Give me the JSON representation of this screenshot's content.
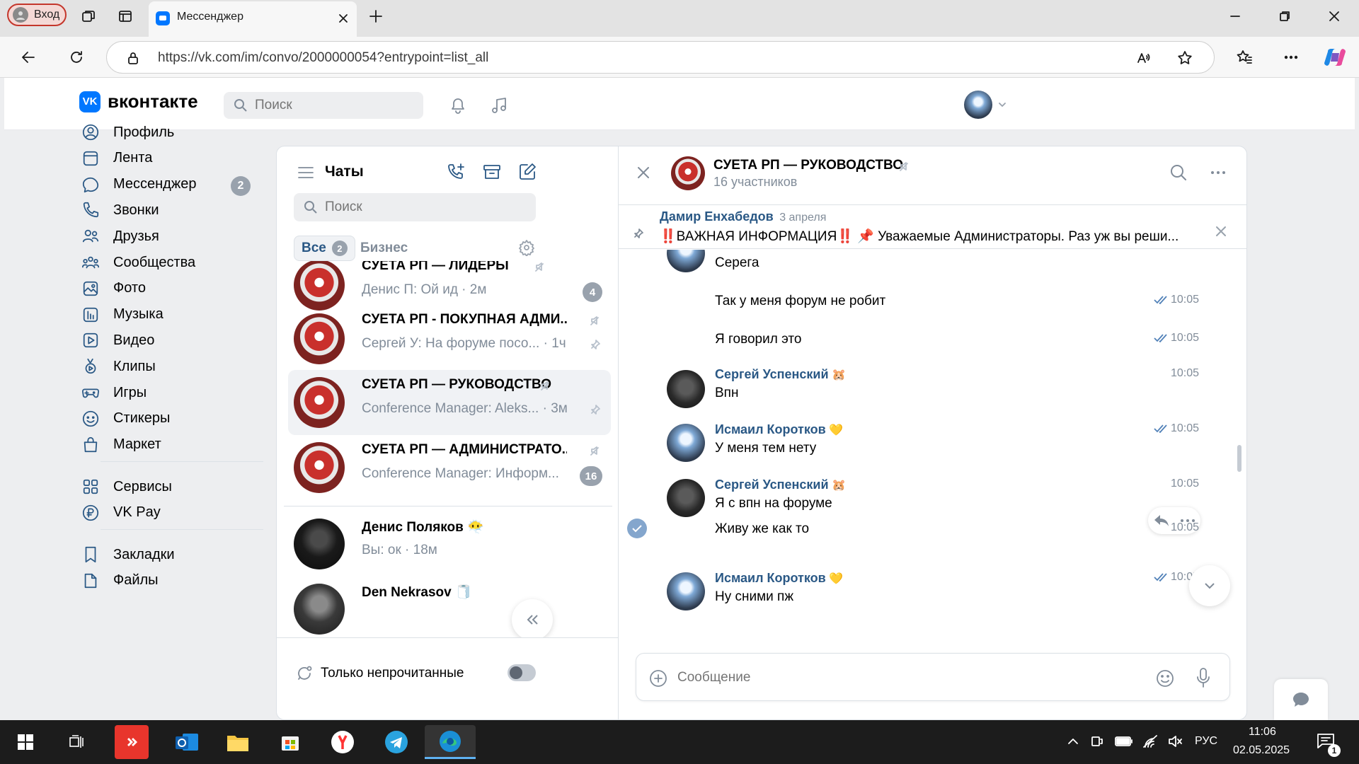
{
  "browser": {
    "profile_label": "Вход",
    "tab_title": "Мессенджер",
    "url": "https://vk.com/im/convo/2000000054?entrypoint=list_all"
  },
  "header": {
    "logo_text": "вконтакте",
    "search_placeholder": "Поиск"
  },
  "sidebar": {
    "items": [
      {
        "label": "Профиль",
        "icon": "profile-icon"
      },
      {
        "label": "Лента",
        "icon": "feed-icon"
      },
      {
        "label": "Мессенджер",
        "icon": "messenger-icon",
        "badge": "2"
      },
      {
        "label": "Звонки",
        "icon": "phone-icon"
      },
      {
        "label": "Друзья",
        "icon": "friends-icon"
      },
      {
        "label": "Сообщества",
        "icon": "communities-icon"
      },
      {
        "label": "Фото",
        "icon": "photo-icon"
      },
      {
        "label": "Музыка",
        "icon": "music-icon"
      },
      {
        "label": "Видео",
        "icon": "video-icon"
      },
      {
        "label": "Клипы",
        "icon": "clips-icon"
      },
      {
        "label": "Игры",
        "icon": "games-icon"
      },
      {
        "label": "Стикеры",
        "icon": "stickers-icon"
      },
      {
        "label": "Маркет",
        "icon": "market-icon"
      }
    ],
    "items2": [
      {
        "label": "Сервисы",
        "icon": "services-icon"
      },
      {
        "label": "VK Pay",
        "icon": "vkpay-icon"
      }
    ],
    "items3": [
      {
        "label": "Закладки",
        "icon": "bookmarks-icon"
      },
      {
        "label": "Файлы",
        "icon": "files-icon"
      }
    ]
  },
  "chatlist": {
    "title": "Чаты",
    "search_placeholder": "Поиск",
    "tabs": [
      {
        "label": "Все",
        "badge": "2"
      },
      {
        "label": "Бизнес"
      }
    ],
    "chats": [
      {
        "name": "СУЕТА РП — ЛИДЕРЫ",
        "preview": "Денис П: Ой ид · 2м",
        "count": "4",
        "muted": true
      },
      {
        "name": "СУЕТА РП - ПОКУПНАЯ АДМИ...",
        "preview": "Сергей У: На форуме посо... · 1ч",
        "muted": true,
        "pinned": true
      },
      {
        "name": "СУЕТА РП — РУКОВОДСТВО",
        "preview": "Conference Manager: Aleks... · 3м",
        "muted": true,
        "pinned": true,
        "active": true
      },
      {
        "name": "СУЕТА РП — АДМИНИСТРАТО...",
        "preview": "Conference Manager: Информ...",
        "count": "16",
        "muted": true
      },
      {
        "name": "Денис Поляков 😶‍🌫️",
        "preview": "Вы: ок · 18м"
      },
      {
        "name": "Den Nekrasov 🧻",
        "preview": ""
      }
    ],
    "unread_only_label": "Только непрочитанные"
  },
  "conversation": {
    "title": "СУЕТА РП — РУКОВОДСТВО",
    "subtitle": "16 участников",
    "pinned": {
      "author": "Дамир Енхабедов",
      "date": "3 апреля",
      "text": "‼️ВАЖНАЯ ИНФОРМАЦИЯ‼️ 📌 Уважаемые Администраторы. Раз уж вы реши..."
    },
    "messages": [
      {
        "text": "Серега"
      },
      {
        "text": "Так у меня форум не робит",
        "time": "10:05",
        "read": true
      },
      {
        "text": "Я говорил это",
        "time": "10:05",
        "read": true
      },
      {
        "author": "Сергей Успенский",
        "emoji": "🐹",
        "text": "Впн",
        "time": "10:05"
      },
      {
        "author": "Исмаил Коротков",
        "emoji": "💛",
        "text": "У меня тем нету",
        "time": "10:05",
        "read": true
      },
      {
        "author": "Сергей Успенский",
        "emoji": "🐹",
        "text": "Я с впн на форуме",
        "time": "10:05"
      },
      {
        "text": "Живу же как то",
        "time": "10:05"
      },
      {
        "author": "Исмаил Коротков",
        "emoji": "💛",
        "text": "Ну сними пж",
        "time": "10:05",
        "read": true
      }
    ],
    "compose_placeholder": "Сообщение"
  },
  "taskbar": {
    "lang": "РУС",
    "time": "11:06",
    "date": "02.05.2025",
    "notif_count": "1"
  },
  "colors": {
    "vk_blue": "#0077ff",
    "link": "#2a5885",
    "muted_text": "#818c99",
    "badge_grey": "#99a2ad"
  }
}
